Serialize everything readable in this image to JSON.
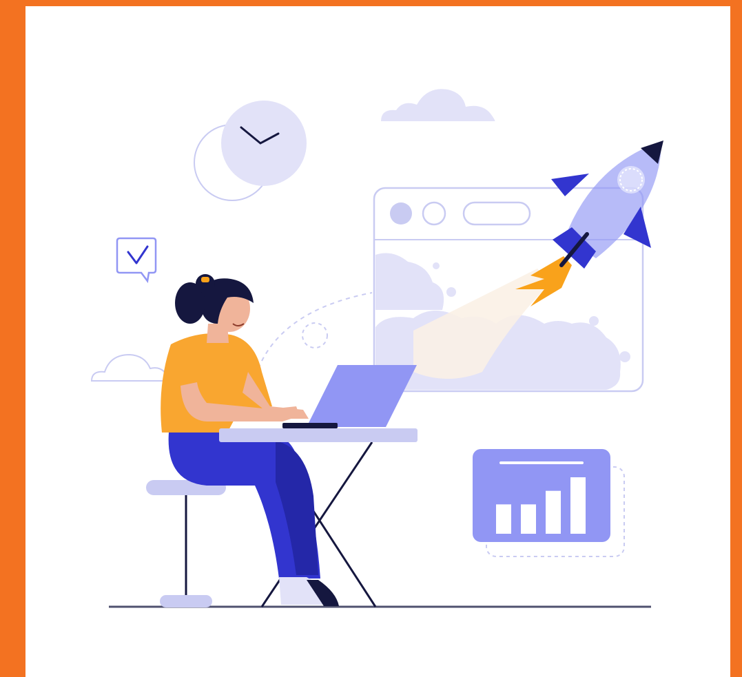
{
  "colors": {
    "frame_orange": "#F37221",
    "canvas_white": "#FFFFFF",
    "lavender": "#E2E2F8",
    "periwinkle": "#9196F4",
    "indigo_dark": "#3235CF",
    "navy": "#15173F",
    "shirt_orange": "#F9A630",
    "skin": "#F0B49A",
    "flame": "#F9A21B",
    "outline": "#C9CBF2"
  },
  "icons": {
    "clock": "clock-icon",
    "check_bubble": "check-bubble-icon",
    "bar_chart": "bar-chart-icon",
    "rocket": "rocket-icon"
  },
  "bar_chart_levels": [
    0.52,
    0.52,
    0.76,
    1.0
  ]
}
